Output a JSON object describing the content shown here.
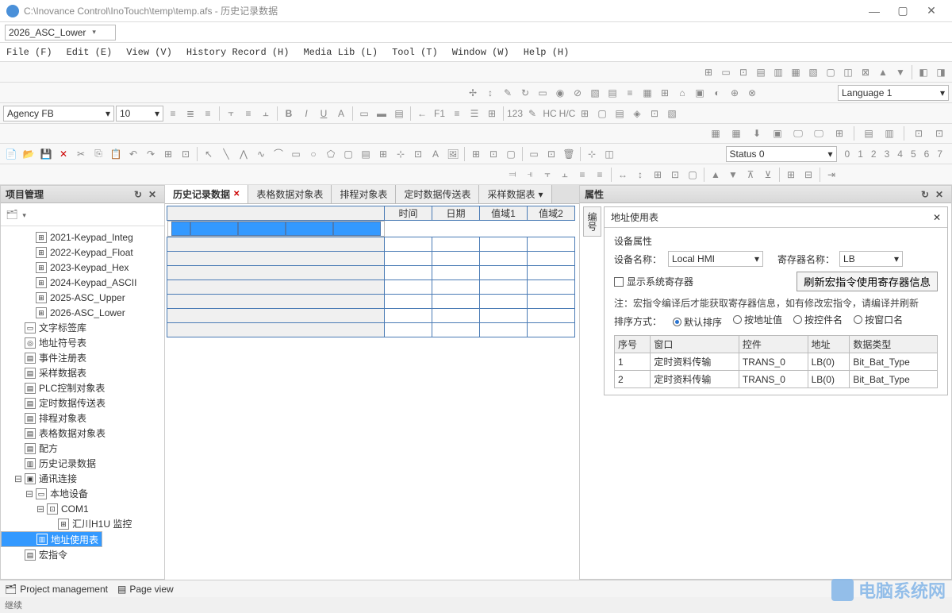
{
  "titlebar": {
    "path": "C:\\Inovance Control\\InoTouch\\temp\\temp.afs - 历史记录数据"
  },
  "top_combo": {
    "value": "2026_ASC_Lower"
  },
  "menu": [
    "File (F)",
    "Edit (E)",
    "View (V)",
    "History Record (H)",
    "Media Lib (L)",
    "Tool (T)",
    "Window (W)",
    "Help (H)"
  ],
  "font_toolbar": {
    "font": "Agency FB",
    "size": "10"
  },
  "language_label": "Language 1",
  "status_row": {
    "label": "Status 0",
    "numbers": [
      "0",
      "1",
      "2",
      "3",
      "4",
      "5",
      "6",
      "7"
    ]
  },
  "left_panel": {
    "title": "项目管理",
    "items": [
      {
        "label": "2021-Keypad_Integ",
        "lvl": 1,
        "icon": "⊞"
      },
      {
        "label": "2022-Keypad_Float",
        "lvl": 1,
        "icon": "⊞"
      },
      {
        "label": "2023-Keypad_Hex",
        "lvl": 1,
        "icon": "⊞"
      },
      {
        "label": "2024-Keypad_ASCII",
        "lvl": 1,
        "icon": "⊞"
      },
      {
        "label": "2025-ASC_Upper",
        "lvl": 1,
        "icon": "⊞"
      },
      {
        "label": "2026-ASC_Lower",
        "lvl": 1,
        "icon": "⊞"
      },
      {
        "label": "文字标签库",
        "lvl": 0,
        "icon": "▭"
      },
      {
        "label": "地址符号表",
        "lvl": 0,
        "icon": "◎"
      },
      {
        "label": "事件注册表",
        "lvl": 0,
        "icon": "▤"
      },
      {
        "label": "采样数据表",
        "lvl": 0,
        "icon": "▤"
      },
      {
        "label": "PLC控制对象表",
        "lvl": 0,
        "icon": "▤"
      },
      {
        "label": "定时数据传送表",
        "lvl": 0,
        "icon": "▤"
      },
      {
        "label": "排程对象表",
        "lvl": 0,
        "icon": "▤"
      },
      {
        "label": "表格数据对象表",
        "lvl": 0,
        "icon": "▤"
      },
      {
        "label": "配方",
        "lvl": 0,
        "icon": "▤"
      },
      {
        "label": "历史记录数据",
        "lvl": 0,
        "icon": "▥"
      },
      {
        "label": "通讯连接",
        "lvl": 0,
        "icon": "▣",
        "expand": "⊟"
      },
      {
        "label": "本地设备",
        "lvl": 1,
        "icon": "▭",
        "expand": "⊟"
      },
      {
        "label": "COM1",
        "lvl": 2,
        "icon": "⊡",
        "expand": "⊟"
      },
      {
        "label": "汇川H1U 监控",
        "lvl": 3,
        "icon": "⊞"
      },
      {
        "label": "地址使用表",
        "lvl": 1,
        "icon": "▥",
        "sel": true
      },
      {
        "label": "宏指令",
        "lvl": 0,
        "icon": "▤"
      }
    ]
  },
  "center": {
    "tabs": [
      {
        "label": "历史记录数据",
        "active": true,
        "closable": true
      },
      {
        "label": "表格数据对象表"
      },
      {
        "label": "排程对象表"
      },
      {
        "label": "定时数据传送表"
      },
      {
        "label": "采样数据表",
        "dropdown": true
      }
    ],
    "grid_headers": [
      "时间",
      "日期",
      "值域1",
      "值域2"
    ],
    "grid_rows": 8
  },
  "right_panel": {
    "title": "属性",
    "sub_tab": "编号",
    "addr_title": "地址使用表",
    "device_props_label": "设备属性",
    "device_name_label": "设备名称：",
    "device_name_value": "Local HMI",
    "register_name_label": "寄存器名称：",
    "register_name_value": "LB",
    "show_sys_reg_label": "显示系统寄存器",
    "refresh_btn": "刷新宏指令使用寄存器信息",
    "note": "注：宏指令编译后才能获取寄存器信息，如有修改宏指令，请编译并刷新",
    "sort_label": "排序方式：",
    "sort_options": [
      {
        "label": "默认排序",
        "checked": true
      },
      {
        "label": "按地址值"
      },
      {
        "label": "按控件名"
      },
      {
        "label": "按窗口名"
      }
    ],
    "table_headers": [
      "序号",
      "窗口",
      "控件",
      "地址",
      "数据类型"
    ],
    "table_rows": [
      {
        "id": "1",
        "win": "定时资料传输",
        "ctrl": "TRANS_0",
        "addr": "LB(0)",
        "type": "Bit_Bat_Type"
      },
      {
        "id": "2",
        "win": "定时资料传输",
        "ctrl": "TRANS_0",
        "addr": "LB(0)",
        "type": "Bit_Bat_Type"
      }
    ]
  },
  "statusbar": {
    "items": [
      "Project management",
      "Page view"
    ],
    "bottom": "继续"
  },
  "watermark": "电脑系统网"
}
